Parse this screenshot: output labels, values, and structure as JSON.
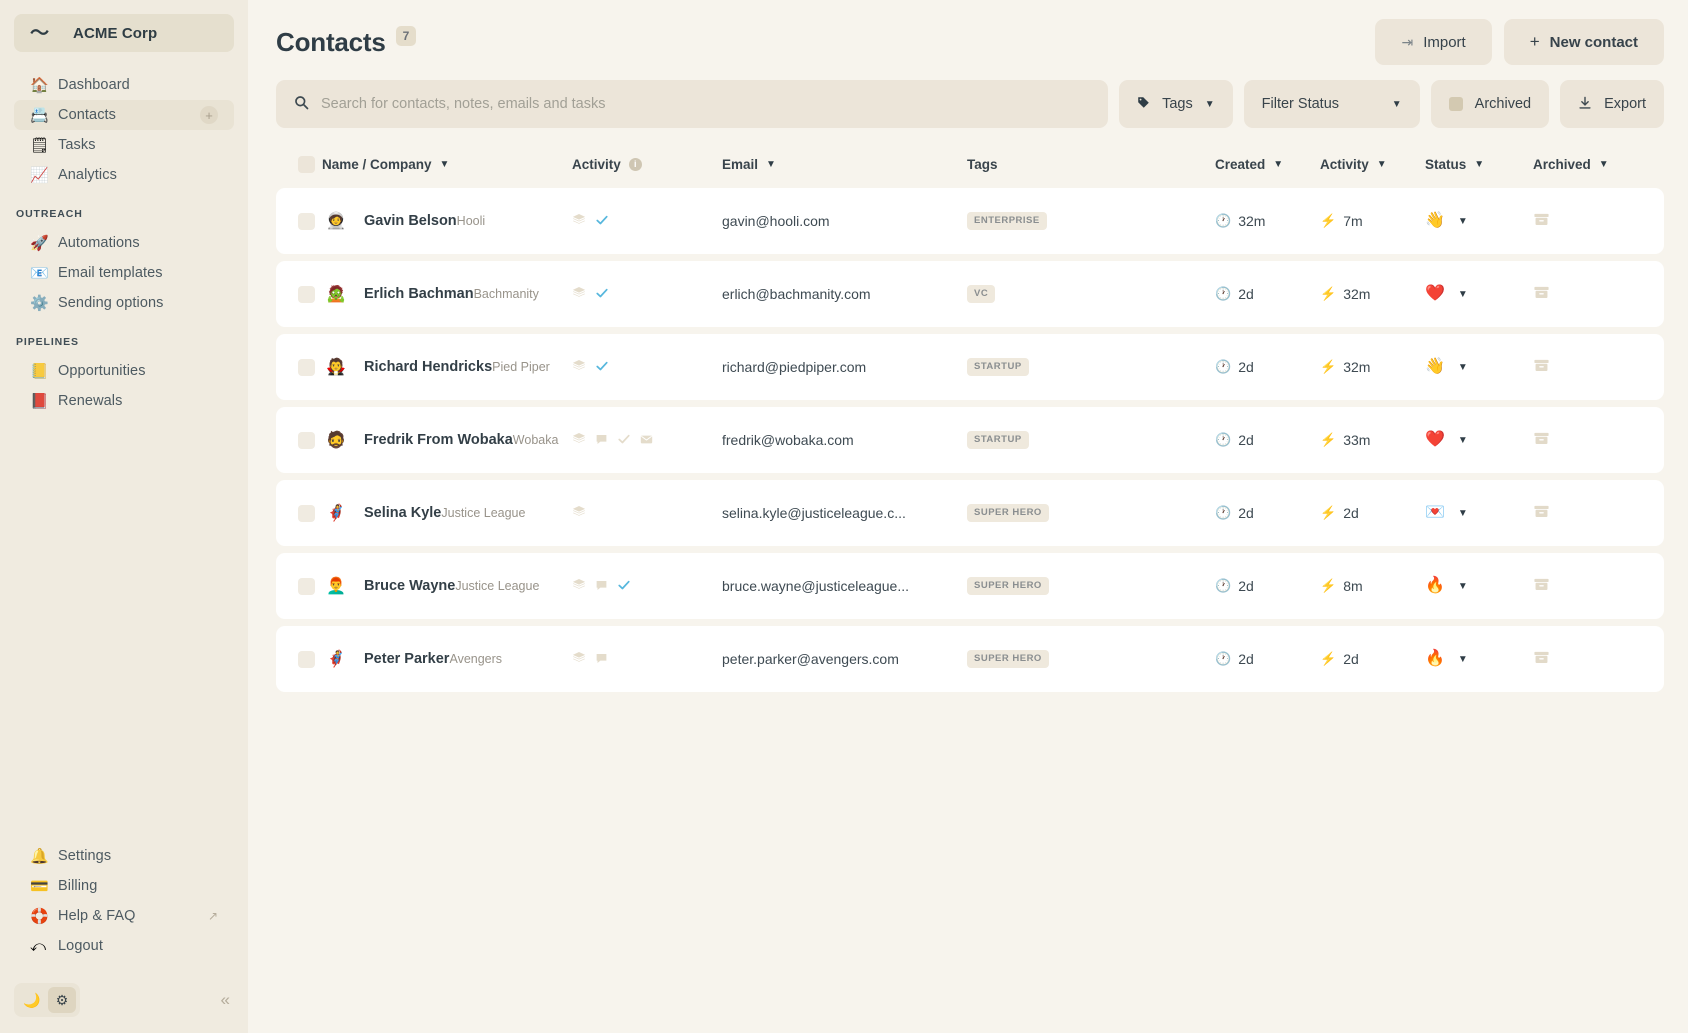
{
  "sidebar": {
    "brand": {
      "logo": "〜",
      "name": "ACME Corp"
    },
    "nav_main": [
      {
        "icon": "🏠",
        "label": "Dashboard",
        "active": false,
        "trail": ""
      },
      {
        "icon": "📇",
        "label": "Contacts",
        "active": true,
        "trail": "+"
      },
      {
        "icon": "🗒",
        "label": "Tasks",
        "active": false,
        "trail": ""
      },
      {
        "icon": "📈",
        "label": "Analytics",
        "active": false,
        "trail": ""
      }
    ],
    "section_outreach": "OUTREACH",
    "nav_outreach": [
      {
        "icon": "🚀",
        "label": "Automations"
      },
      {
        "icon": "📧",
        "label": "Email templates"
      },
      {
        "icon": "⚙️",
        "label": "Sending options"
      }
    ],
    "section_pipelines": "PIPELINES",
    "nav_pipelines": [
      {
        "icon": "📒",
        "label": "Opportunities"
      },
      {
        "icon": "📕",
        "label": "Renewals"
      }
    ],
    "nav_bottom": [
      {
        "icon": "🔔",
        "label": "Settings",
        "external": false
      },
      {
        "icon": "💳",
        "label": "Billing",
        "external": false
      },
      {
        "icon": "🛟",
        "label": "Help & FAQ",
        "external": true
      },
      {
        "icon": "⤺",
        "label": "Logout",
        "external": false
      }
    ],
    "footer": {
      "dark_mode_icon": "🌙",
      "theme_icon": "⚙",
      "collapse_icon": "«"
    }
  },
  "header": {
    "title": "Contacts",
    "count": "7",
    "import_label": "Import",
    "import_icon": "⇥",
    "new_contact_label": "New contact",
    "new_contact_icon": "+"
  },
  "filters": {
    "search_placeholder": "Search for contacts, notes, emails and tasks",
    "search_value": "",
    "search_icon": "🔍",
    "tags_label": "Tags",
    "tags_icon": "🏷",
    "status_label": "Filter Status",
    "archived_label": "Archived",
    "export_label": "Export",
    "export_icon": "⤓",
    "caret": "▼"
  },
  "table": {
    "columns": {
      "name": "Name / Company",
      "activity": "Activity",
      "email": "Email",
      "tags": "Tags",
      "created": "Created",
      "last_activity": "Activity",
      "status": "Status",
      "archived": "Archived"
    },
    "caret": "▼",
    "info_icon": "i",
    "rows": [
      {
        "avatar": "🧑‍🚀",
        "name": "Gavin Belson",
        "company": "Hooli",
        "activity_icons": [
          "stack",
          "check"
        ],
        "email": "gavin@hooli.com",
        "tags": [
          "ENTERPRISE"
        ],
        "created": "32m",
        "last_activity": "7m",
        "status_emoji": "👋",
        "archived_icon": "🗃"
      },
      {
        "avatar": "🧟",
        "name": "Erlich Bachman",
        "company": "Bachmanity",
        "activity_icons": [
          "stack",
          "check"
        ],
        "email": "erlich@bachmanity.com",
        "tags": [
          "VC"
        ],
        "created": "2d",
        "last_activity": "32m",
        "status_emoji": "❤️",
        "archived_icon": "🗃"
      },
      {
        "avatar": "🧛",
        "name": "Richard Hendricks",
        "company": "Pied Piper",
        "activity_icons": [
          "stack",
          "check"
        ],
        "email": "richard@piedpiper.com",
        "tags": [
          "STARTUP"
        ],
        "created": "2d",
        "last_activity": "32m",
        "status_emoji": "👋",
        "archived_icon": "🗃"
      },
      {
        "avatar": "🧔",
        "name": "Fredrik From Wobaka",
        "company": "Wobaka",
        "activity_icons": [
          "stack",
          "chat",
          "check-dim",
          "mail"
        ],
        "email": "fredrik@wobaka.com",
        "tags": [
          "STARTUP"
        ],
        "created": "2d",
        "last_activity": "33m",
        "status_emoji": "❤️",
        "archived_icon": "🗃"
      },
      {
        "avatar": "🦸‍♀️",
        "name": "Selina Kyle",
        "company": "Justice League",
        "activity_icons": [
          "stack"
        ],
        "email": "selina.kyle@justiceleague.c...",
        "tags": [
          "SUPER HERO"
        ],
        "created": "2d",
        "last_activity": "2d",
        "status_emoji": "💌",
        "archived_icon": "🗃"
      },
      {
        "avatar": "👨‍🦰",
        "name": "Bruce Wayne",
        "company": "Justice League",
        "activity_icons": [
          "stack",
          "chat",
          "check"
        ],
        "email": "bruce.wayne@justiceleague...",
        "tags": [
          "SUPER HERO"
        ],
        "created": "2d",
        "last_activity": "8m",
        "status_emoji": "🔥",
        "archived_icon": "🗃"
      },
      {
        "avatar": "🦸",
        "name": "Peter Parker",
        "company": "Avengers",
        "activity_icons": [
          "stack",
          "chat"
        ],
        "email": "peter.parker@avengers.com",
        "tags": [
          "SUPER HERO"
        ],
        "created": "2d",
        "last_activity": "2d",
        "status_emoji": "🔥",
        "archived_icon": "🗃"
      }
    ]
  }
}
